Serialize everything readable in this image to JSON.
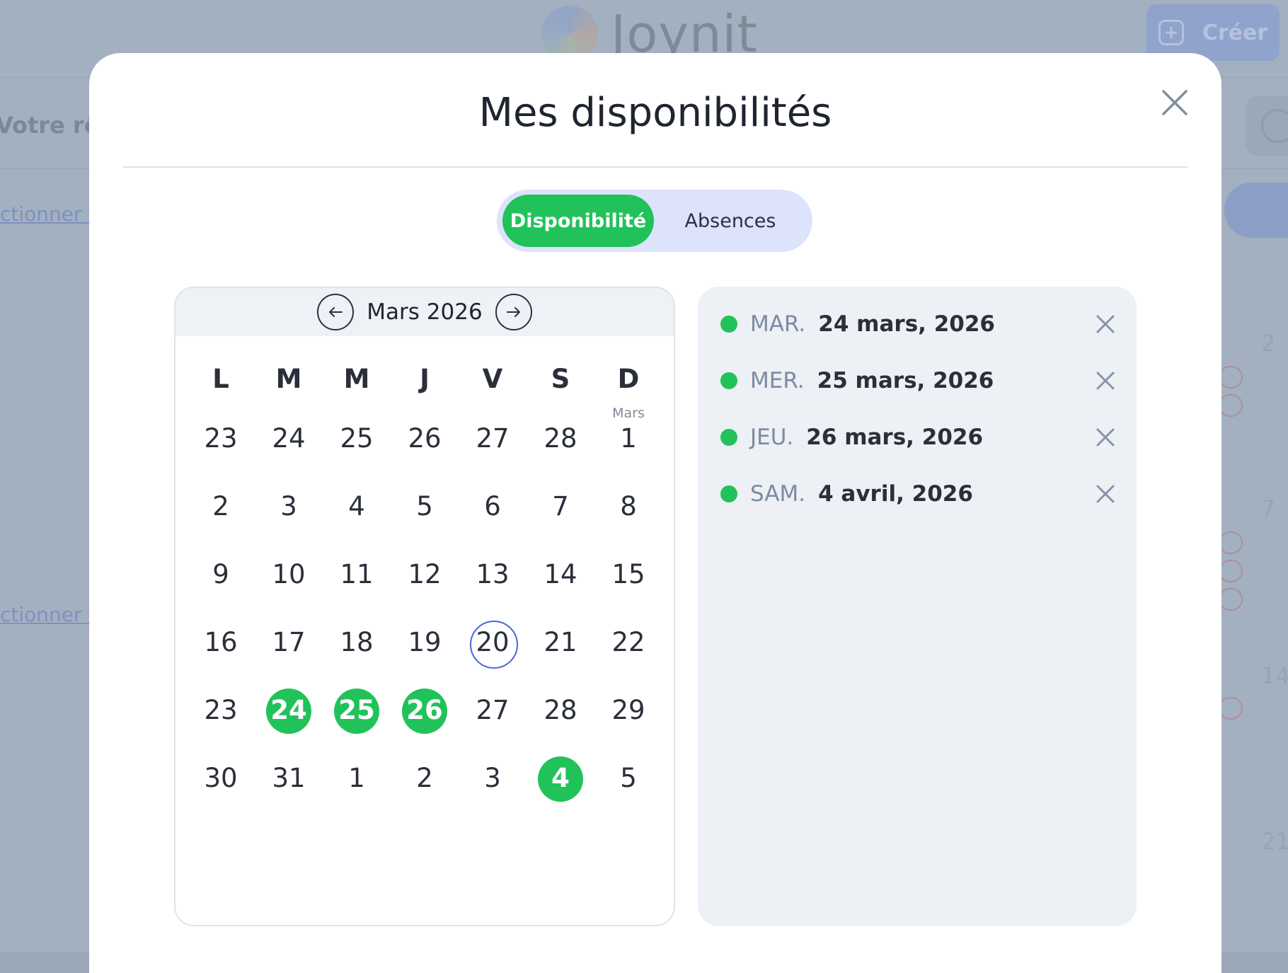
{
  "background": {
    "logo_text": "Joynit",
    "create_label": "Créer",
    "role_text": "Votre rôle",
    "select_link_1": "ctionner to",
    "select_link_2": "ctionner to",
    "side_numbers": [
      "2",
      "7",
      "14",
      "21"
    ]
  },
  "modal": {
    "title": "Mes disponibilités",
    "tabs": [
      {
        "label": "Disponibilité",
        "active": true
      },
      {
        "label": "Absences",
        "active": false
      }
    ]
  },
  "calendar": {
    "month_label": "Mars 2026",
    "weekdays": [
      "L",
      "M",
      "M",
      "J",
      "V",
      "S",
      "D"
    ],
    "month_tag": "Mars",
    "weeks": [
      [
        "23",
        "24",
        "25",
        "26",
        "27",
        "28",
        "1"
      ],
      [
        "2",
        "3",
        "4",
        "5",
        "6",
        "7",
        "8"
      ],
      [
        "9",
        "10",
        "11",
        "12",
        "13",
        "14",
        "15"
      ],
      [
        "16",
        "17",
        "18",
        "19",
        "20",
        "21",
        "22"
      ],
      [
        "23",
        "24",
        "25",
        "26",
        "27",
        "28",
        "29"
      ],
      [
        "30",
        "31",
        "1",
        "2",
        "3",
        "4",
        "5"
      ]
    ],
    "today": "20",
    "selected": [
      "24",
      "25",
      "26",
      "4"
    ]
  },
  "availability": [
    {
      "day": "MAR.",
      "date": "24 mars, 2026"
    },
    {
      "day": "MER.",
      "date": "25 mars, 2026"
    },
    {
      "day": "JEU.",
      "date": "26 mars, 2026"
    },
    {
      "day": "SAM.",
      "date": "4 avril, 2026"
    }
  ],
  "colors": {
    "accent_green": "#21c25a",
    "today_ring": "#4a66d6",
    "toggle_bg": "#dde3fb"
  }
}
